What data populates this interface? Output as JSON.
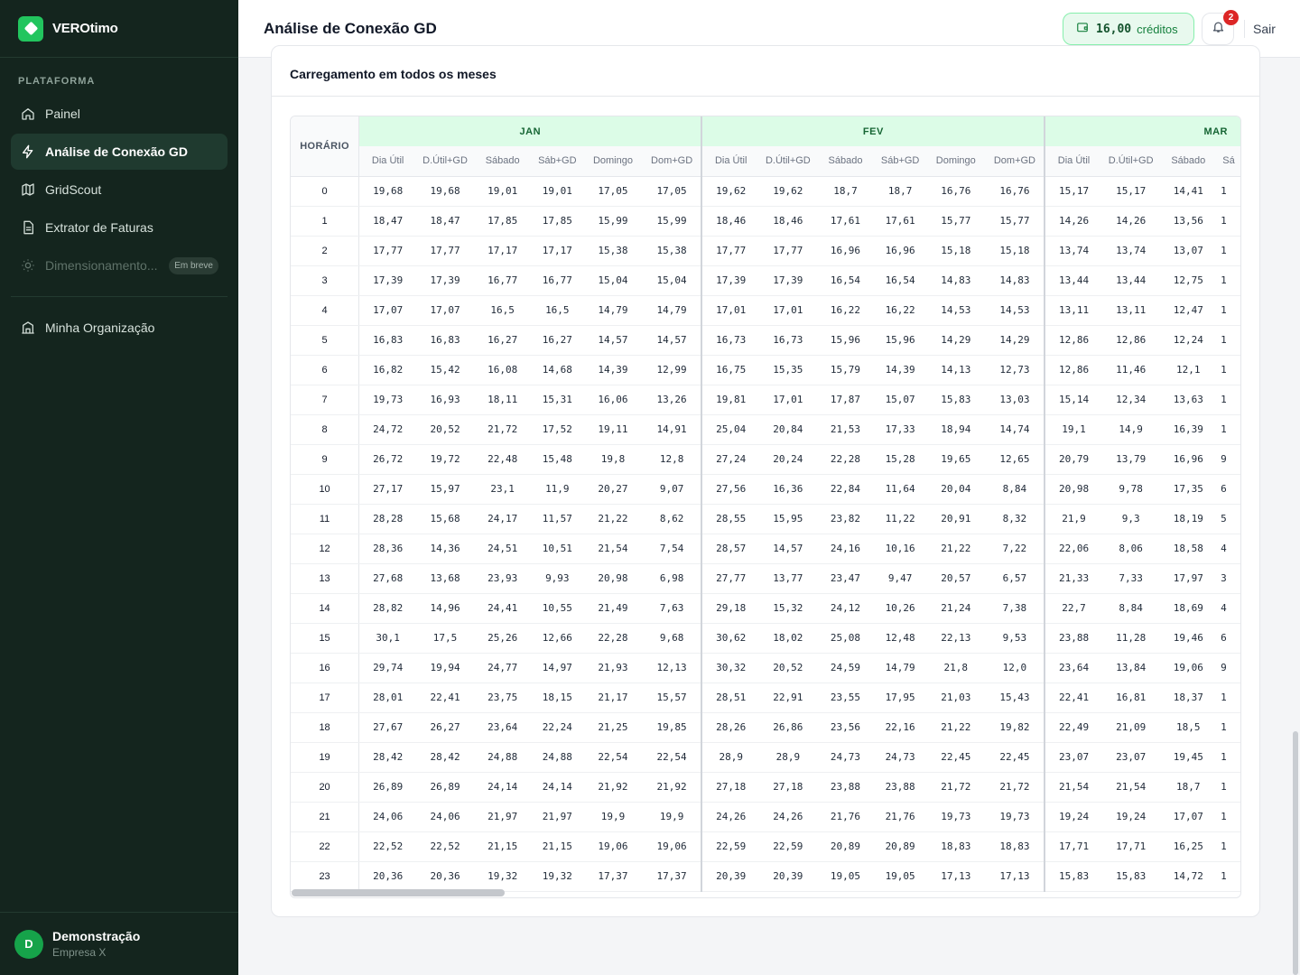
{
  "brand": {
    "name": "VEROtimo"
  },
  "sidebar": {
    "section_label": "PLATAFORMA",
    "items": [
      {
        "label": "Painel",
        "icon": "home-icon"
      },
      {
        "label": "Análise de Conexão GD",
        "icon": "bolt-icon"
      },
      {
        "label": "GridScout",
        "icon": "map-icon"
      },
      {
        "label": "Extrator de Faturas",
        "icon": "file-icon"
      },
      {
        "label": "Dimensionamento...",
        "icon": "sun-icon",
        "badge": "Em breve"
      }
    ],
    "org_item": {
      "label": "Minha Organização",
      "icon": "building-icon"
    }
  },
  "user": {
    "initial": "D",
    "name": "Demonstração",
    "org": "Empresa X"
  },
  "header": {
    "title": "Análise de Conexão GD",
    "credits_value": "16,00",
    "credits_label": "créditos",
    "notifications_count": "2",
    "logout_label": "Sair"
  },
  "card": {
    "title": "Carregamento em todos os meses"
  },
  "table": {
    "hour_header": "HORÁRIO",
    "months": [
      "JAN",
      "FEV",
      "MAR"
    ],
    "sub_headers": [
      "Dia Útil",
      "D.Útil+GD",
      "Sábado",
      "Sáb+GD",
      "Domingo",
      "Dom+GD"
    ],
    "visible_sub_headers_last_month": [
      "Dia Útil",
      "D.Útil+GD",
      "Sábado",
      "Sá"
    ],
    "rows": [
      {
        "h": "0",
        "jan": [
          "19,68",
          "19,68",
          "19,01",
          "19,01",
          "17,05",
          "17,05"
        ],
        "fev": [
          "19,62",
          "19,62",
          "18,7",
          "18,7",
          "16,76",
          "16,76"
        ],
        "mar": [
          "15,17",
          "15,17",
          "14,41",
          "1"
        ]
      },
      {
        "h": "1",
        "jan": [
          "18,47",
          "18,47",
          "17,85",
          "17,85",
          "15,99",
          "15,99"
        ],
        "fev": [
          "18,46",
          "18,46",
          "17,61",
          "17,61",
          "15,77",
          "15,77"
        ],
        "mar": [
          "14,26",
          "14,26",
          "13,56",
          "1"
        ]
      },
      {
        "h": "2",
        "jan": [
          "17,77",
          "17,77",
          "17,17",
          "17,17",
          "15,38",
          "15,38"
        ],
        "fev": [
          "17,77",
          "17,77",
          "16,96",
          "16,96",
          "15,18",
          "15,18"
        ],
        "mar": [
          "13,74",
          "13,74",
          "13,07",
          "1"
        ]
      },
      {
        "h": "3",
        "jan": [
          "17,39",
          "17,39",
          "16,77",
          "16,77",
          "15,04",
          "15,04"
        ],
        "fev": [
          "17,39",
          "17,39",
          "16,54",
          "16,54",
          "14,83",
          "14,83"
        ],
        "mar": [
          "13,44",
          "13,44",
          "12,75",
          "1"
        ]
      },
      {
        "h": "4",
        "jan": [
          "17,07",
          "17,07",
          "16,5",
          "16,5",
          "14,79",
          "14,79"
        ],
        "fev": [
          "17,01",
          "17,01",
          "16,22",
          "16,22",
          "14,53",
          "14,53"
        ],
        "mar": [
          "13,11",
          "13,11",
          "12,47",
          "1"
        ]
      },
      {
        "h": "5",
        "jan": [
          "16,83",
          "16,83",
          "16,27",
          "16,27",
          "14,57",
          "14,57"
        ],
        "fev": [
          "16,73",
          "16,73",
          "15,96",
          "15,96",
          "14,29",
          "14,29"
        ],
        "mar": [
          "12,86",
          "12,86",
          "12,24",
          "1"
        ]
      },
      {
        "h": "6",
        "jan": [
          "16,82",
          "15,42",
          "16,08",
          "14,68",
          "14,39",
          "12,99"
        ],
        "fev": [
          "16,75",
          "15,35",
          "15,79",
          "14,39",
          "14,13",
          "12,73"
        ],
        "mar": [
          "12,86",
          "11,46",
          "12,1",
          "1"
        ]
      },
      {
        "h": "7",
        "jan": [
          "19,73",
          "16,93",
          "18,11",
          "15,31",
          "16,06",
          "13,26"
        ],
        "fev": [
          "19,81",
          "17,01",
          "17,87",
          "15,07",
          "15,83",
          "13,03"
        ],
        "mar": [
          "15,14",
          "12,34",
          "13,63",
          "1"
        ]
      },
      {
        "h": "8",
        "jan": [
          "24,72",
          "20,52",
          "21,72",
          "17,52",
          "19,11",
          "14,91"
        ],
        "fev": [
          "25,04",
          "20,84",
          "21,53",
          "17,33",
          "18,94",
          "14,74"
        ],
        "mar": [
          "19,1",
          "14,9",
          "16,39",
          "1"
        ]
      },
      {
        "h": "9",
        "jan": [
          "26,72",
          "19,72",
          "22,48",
          "15,48",
          "19,8",
          "12,8"
        ],
        "fev": [
          "27,24",
          "20,24",
          "22,28",
          "15,28",
          "19,65",
          "12,65"
        ],
        "mar": [
          "20,79",
          "13,79",
          "16,96",
          "9"
        ]
      },
      {
        "h": "10",
        "jan": [
          "27,17",
          "15,97",
          "23,1",
          "11,9",
          "20,27",
          "9,07"
        ],
        "fev": [
          "27,56",
          "16,36",
          "22,84",
          "11,64",
          "20,04",
          "8,84"
        ],
        "mar": [
          "20,98",
          "9,78",
          "17,35",
          "6"
        ]
      },
      {
        "h": "11",
        "jan": [
          "28,28",
          "15,68",
          "24,17",
          "11,57",
          "21,22",
          "8,62"
        ],
        "fev": [
          "28,55",
          "15,95",
          "23,82",
          "11,22",
          "20,91",
          "8,32"
        ],
        "mar": [
          "21,9",
          "9,3",
          "18,19",
          "5"
        ]
      },
      {
        "h": "12",
        "jan": [
          "28,36",
          "14,36",
          "24,51",
          "10,51",
          "21,54",
          "7,54"
        ],
        "fev": [
          "28,57",
          "14,57",
          "24,16",
          "10,16",
          "21,22",
          "7,22"
        ],
        "mar": [
          "22,06",
          "8,06",
          "18,58",
          "4"
        ]
      },
      {
        "h": "13",
        "jan": [
          "27,68",
          "13,68",
          "23,93",
          "9,93",
          "20,98",
          "6,98"
        ],
        "fev": [
          "27,77",
          "13,77",
          "23,47",
          "9,47",
          "20,57",
          "6,57"
        ],
        "mar": [
          "21,33",
          "7,33",
          "17,97",
          "3"
        ]
      },
      {
        "h": "14",
        "jan": [
          "28,82",
          "14,96",
          "24,41",
          "10,55",
          "21,49",
          "7,63"
        ],
        "fev": [
          "29,18",
          "15,32",
          "24,12",
          "10,26",
          "21,24",
          "7,38"
        ],
        "mar": [
          "22,7",
          "8,84",
          "18,69",
          "4"
        ]
      },
      {
        "h": "15",
        "jan": [
          "30,1",
          "17,5",
          "25,26",
          "12,66",
          "22,28",
          "9,68"
        ],
        "fev": [
          "30,62",
          "18,02",
          "25,08",
          "12,48",
          "22,13",
          "9,53"
        ],
        "mar": [
          "23,88",
          "11,28",
          "19,46",
          "6"
        ]
      },
      {
        "h": "16",
        "jan": [
          "29,74",
          "19,94",
          "24,77",
          "14,97",
          "21,93",
          "12,13"
        ],
        "fev": [
          "30,32",
          "20,52",
          "24,59",
          "14,79",
          "21,8",
          "12,0"
        ],
        "mar": [
          "23,64",
          "13,84",
          "19,06",
          "9"
        ]
      },
      {
        "h": "17",
        "jan": [
          "28,01",
          "22,41",
          "23,75",
          "18,15",
          "21,17",
          "15,57"
        ],
        "fev": [
          "28,51",
          "22,91",
          "23,55",
          "17,95",
          "21,03",
          "15,43"
        ],
        "mar": [
          "22,41",
          "16,81",
          "18,37",
          "1"
        ]
      },
      {
        "h": "18",
        "jan": [
          "27,67",
          "26,27",
          "23,64",
          "22,24",
          "21,25",
          "19,85"
        ],
        "fev": [
          "28,26",
          "26,86",
          "23,56",
          "22,16",
          "21,22",
          "19,82"
        ],
        "mar": [
          "22,49",
          "21,09",
          "18,5",
          "1"
        ]
      },
      {
        "h": "19",
        "jan": [
          "28,42",
          "28,42",
          "24,88",
          "24,88",
          "22,54",
          "22,54"
        ],
        "fev": [
          "28,9",
          "28,9",
          "24,73",
          "24,73",
          "22,45",
          "22,45"
        ],
        "mar": [
          "23,07",
          "23,07",
          "19,45",
          "1"
        ]
      },
      {
        "h": "20",
        "jan": [
          "26,89",
          "26,89",
          "24,14",
          "24,14",
          "21,92",
          "21,92"
        ],
        "fev": [
          "27,18",
          "27,18",
          "23,88",
          "23,88",
          "21,72",
          "21,72"
        ],
        "mar": [
          "21,54",
          "21,54",
          "18,7",
          "1"
        ]
      },
      {
        "h": "21",
        "jan": [
          "24,06",
          "24,06",
          "21,97",
          "21,97",
          "19,9",
          "19,9"
        ],
        "fev": [
          "24,26",
          "24,26",
          "21,76",
          "21,76",
          "19,73",
          "19,73"
        ],
        "mar": [
          "19,24",
          "19,24",
          "17,07",
          "1"
        ]
      },
      {
        "h": "22",
        "jan": [
          "22,52",
          "22,52",
          "21,15",
          "21,15",
          "19,06",
          "19,06"
        ],
        "fev": [
          "22,59",
          "22,59",
          "20,89",
          "20,89",
          "18,83",
          "18,83"
        ],
        "mar": [
          "17,71",
          "17,71",
          "16,25",
          "1"
        ]
      },
      {
        "h": "23",
        "jan": [
          "20,36",
          "20,36",
          "19,32",
          "19,32",
          "17,37",
          "17,37"
        ],
        "fev": [
          "20,39",
          "20,39",
          "19,05",
          "19,05",
          "17,13",
          "17,13"
        ],
        "mar": [
          "15,83",
          "15,83",
          "14,72",
          "1"
        ]
      }
    ]
  }
}
